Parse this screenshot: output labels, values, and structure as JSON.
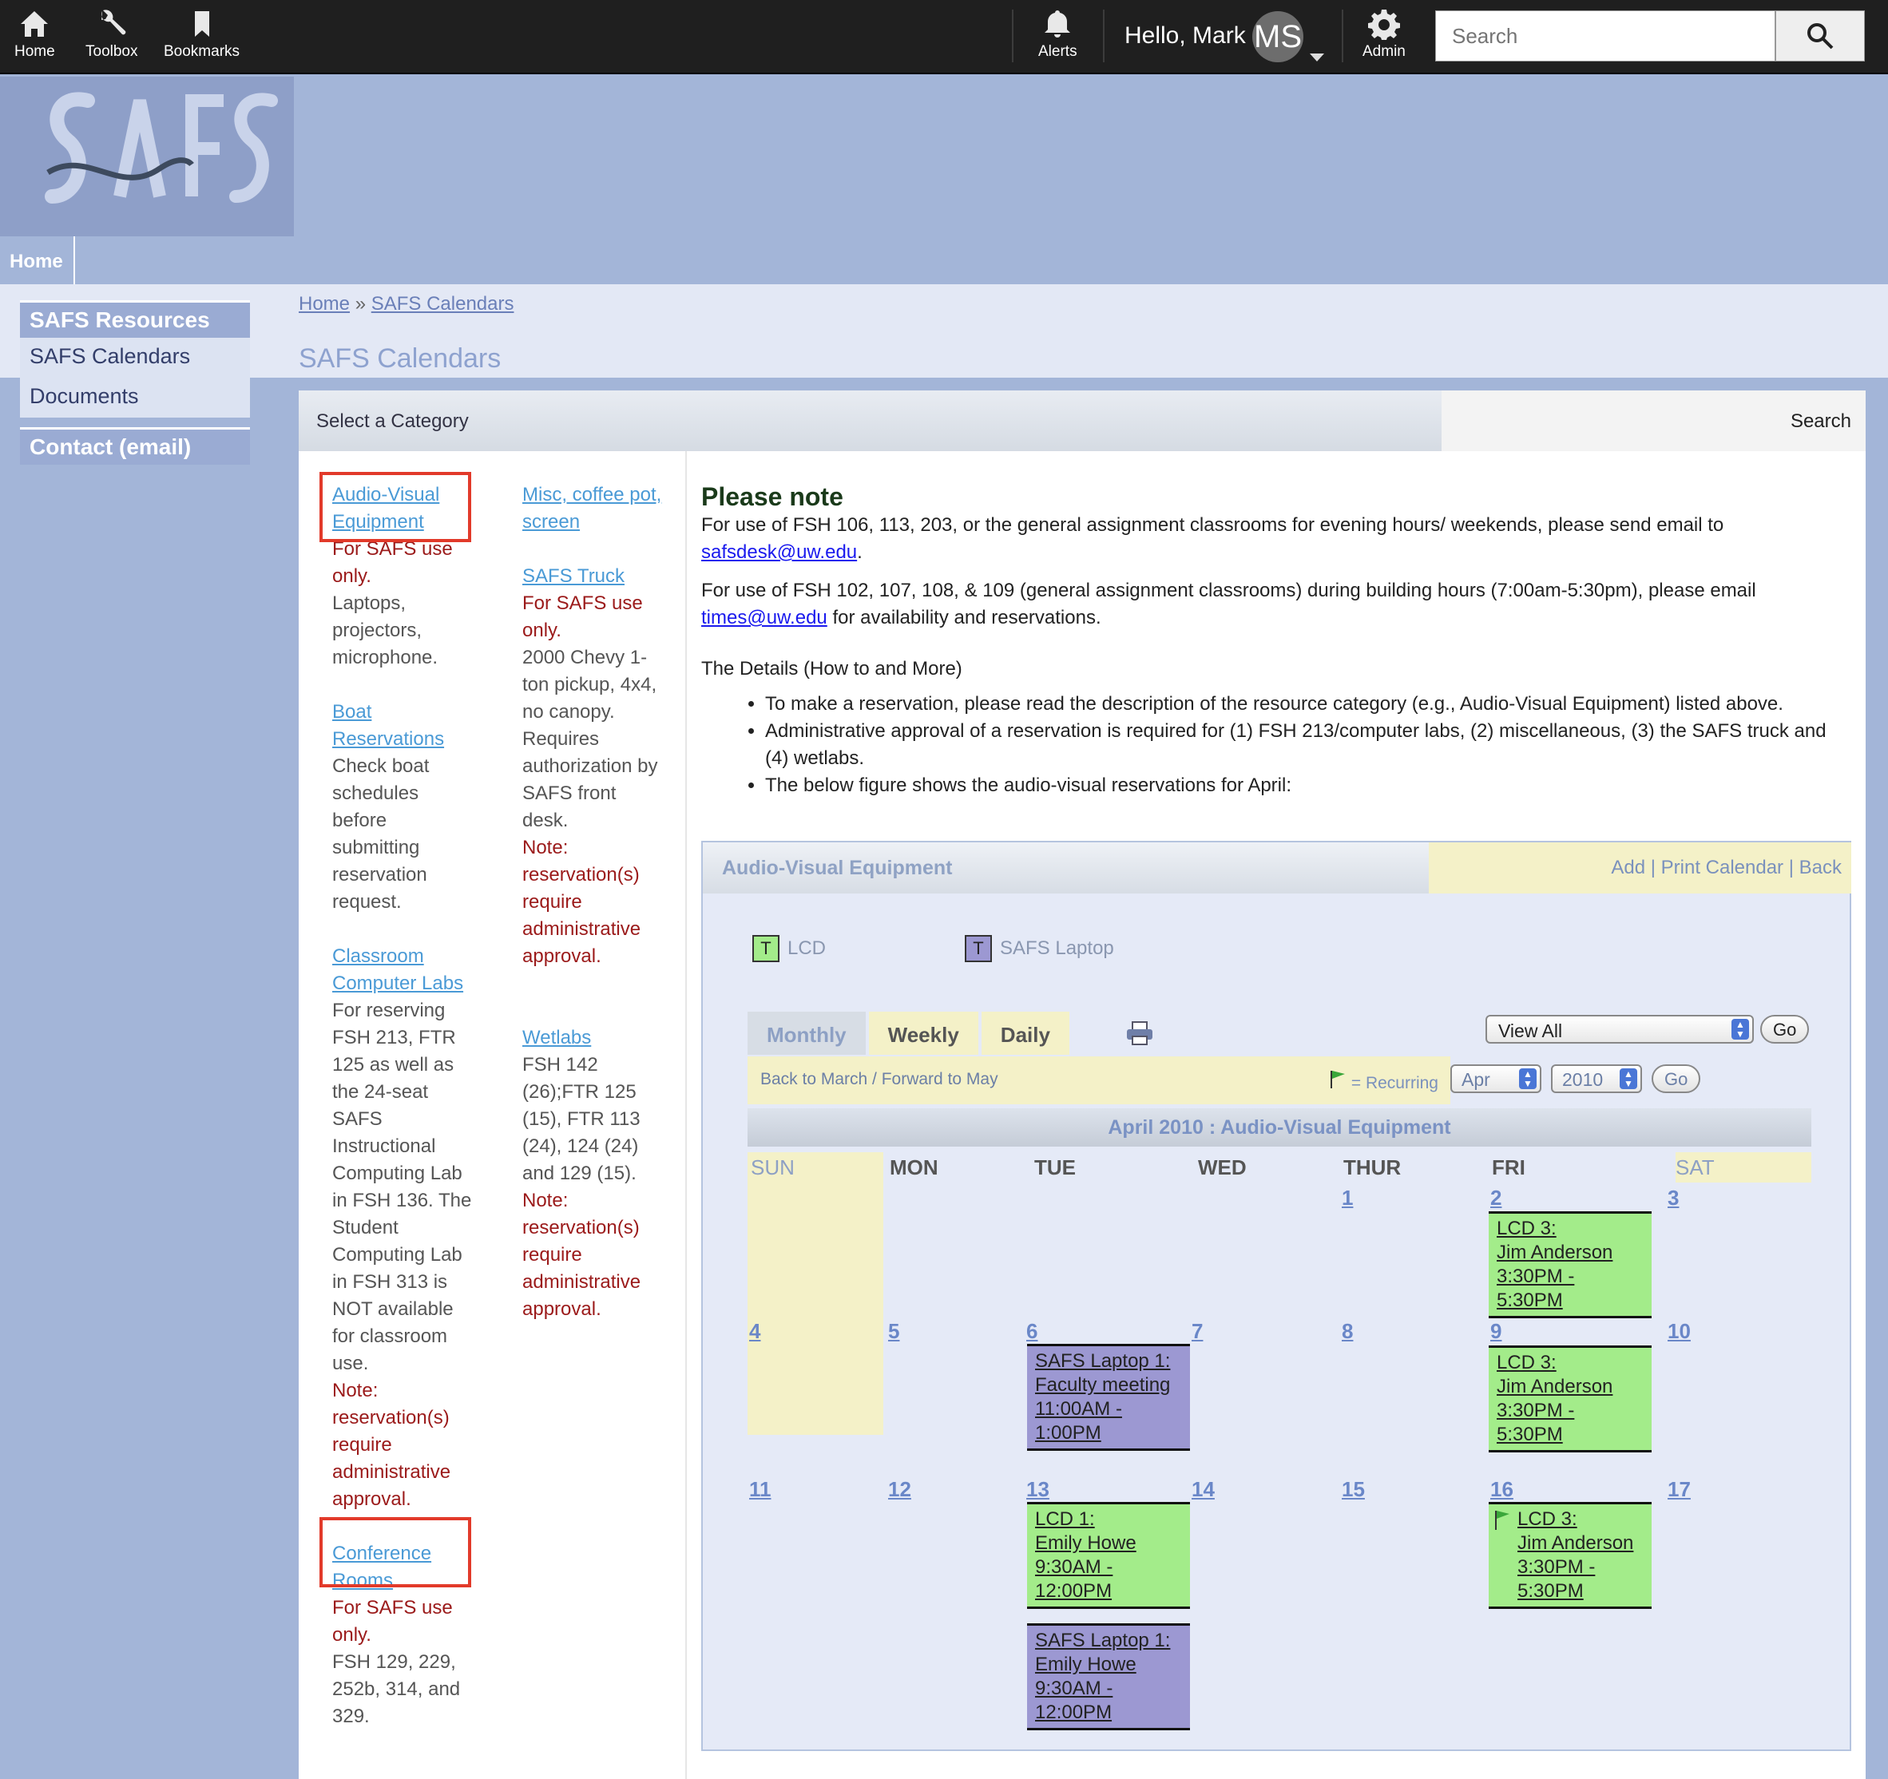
{
  "topbar": {
    "home": "Home",
    "toolbox": "Toolbox",
    "bookmarks": "Bookmarks",
    "alerts": "Alerts",
    "hello": "Hello, Mark",
    "avatar": "MS",
    "admin": "Admin",
    "search_placeholder": "Search"
  },
  "nav": {
    "home": "Home"
  },
  "sidebar": {
    "header": "SAFS Resources",
    "items": [
      "SAFS Calendars",
      "Documents"
    ],
    "contact": "Contact (email)"
  },
  "breadcrumb": {
    "home": "Home",
    "sep": "»",
    "current": "SAFS Calendars"
  },
  "page_title": "SAFS Calendars",
  "category_bar": {
    "label": "Select a Category",
    "search": "Search"
  },
  "categories_left": [
    {
      "link": "Audio-Visual Equipment",
      "red": "For SAFS use only.",
      "text": "Laptops, projectors, microphone.",
      "red2": ""
    },
    {
      "link": "Boat Reservations",
      "red": "",
      "text": "Check boat schedules before submitting reservation request.",
      "red2": ""
    },
    {
      "link": "Classroom Computer Labs",
      "red": "",
      "text": "For reserving FSH 213, FTR 125 as well as the 24-seat SAFS Instructional Computing Lab in FSH 136. The Student Computing Lab in FSH 313 is NOT available for classroom use.",
      "red2": "Note: reservation(s) require administrative approval."
    },
    {
      "link": "Conference Rooms",
      "red": "For SAFS use only.",
      "text": "FSH 129, 229, 252b, 314, and 329.",
      "red2": ""
    }
  ],
  "categories_right": [
    {
      "link": "Misc, coffee pot, screen",
      "red": "",
      "text": "",
      "red2": ""
    },
    {
      "link": "SAFS Truck",
      "red": "For SAFS use only.",
      "text": "2000 Chevy 1-ton pickup, 4x4, no canopy. Requires authorization by SAFS front desk.",
      "red2": "Note: reservation(s) require administrative approval."
    },
    {
      "link": "Wetlabs",
      "red": "",
      "text": "FSH 142 (26);FTR 125 (15), FTR 113 (24), 124 (24) and 129 (15).",
      "red2": "Note: reservation(s) require administrative approval."
    }
  ],
  "note": {
    "title": "Please note",
    "p1": "For use of FSH 106, 113, 203, or the general assignment classrooms for evening hours/ weekends, please send email to",
    "p1_email": "safsdesk@uw.edu",
    "p2": "For use of FSH 102, 107, 108, & 109 (general assignment classrooms) during building hours (7:00am-5:30pm), please email",
    "p2_email": "times@uw.edu",
    "p2_tail": "for availability and reservations.",
    "details": "The Details (How to and More)",
    "bullets": [
      "To make a reservation, please read the description of the resource category (e.g., Audio-Visual Equipment) listed above.",
      "Administrative approval of a reservation is required for (1) FSH 213/computer labs, (2) miscellaneous, (3) the SAFS truck and (4) wetlabs.",
      "The below figure shows the audio-visual reservations for April:"
    ]
  },
  "calendar": {
    "header": "Audio-Visual Equipment",
    "links": [
      "Add",
      "Print Calendar",
      "Back"
    ],
    "legend": [
      {
        "letter": "T",
        "label": "LCD",
        "color": "#a3ec8a"
      },
      {
        "letter": "T",
        "label": "SAFS Laptop",
        "color": "#9c98d2"
      }
    ],
    "tabs": [
      "Monthly",
      "Weekly",
      "Daily"
    ],
    "view_select": "View All",
    "go": "Go",
    "back_forward": "Back to March / Forward to May",
    "recurring": "= Recurring",
    "month_select": "Apr",
    "year_select": "2010",
    "title": "April 2010 : Audio-Visual Equipment",
    "days": [
      "SUN",
      "MON",
      "TUE",
      "WED",
      "THUR",
      "FRI",
      "SAT"
    ],
    "dates": [
      "1",
      "2",
      "3",
      "4",
      "5",
      "6",
      "7",
      "8",
      "9",
      "10",
      "11",
      "12",
      "13",
      "14",
      "15",
      "16",
      "17"
    ],
    "events": [
      {
        "l1": "LCD 3:",
        "l2": "Jim Anderson",
        "l3": "3:30PM - 5:30PM",
        "l4": ""
      },
      {
        "l1": "SAFS Laptop 1:",
        "l2": "Faculty meeting",
        "l3": "11:00AM -",
        "l4": "1:00PM"
      },
      {
        "l1": "LCD 3:",
        "l2": "Jim Anderson",
        "l3": "3:30PM - 5:30PM",
        "l4": ""
      },
      {
        "l1": "LCD 1:",
        "l2": "Emily Howe",
        "l3": "9:30AM -",
        "l4": "12:00PM"
      },
      {
        "l1": "LCD 3:",
        "l2": "Jim Anderson",
        "l3": "3:30PM - 5:30PM",
        "l4": ""
      },
      {
        "l1": "SAFS Laptop 1:",
        "l2": "Emily Howe",
        "l3": "9:30AM -",
        "l4": "12:00PM"
      }
    ]
  }
}
